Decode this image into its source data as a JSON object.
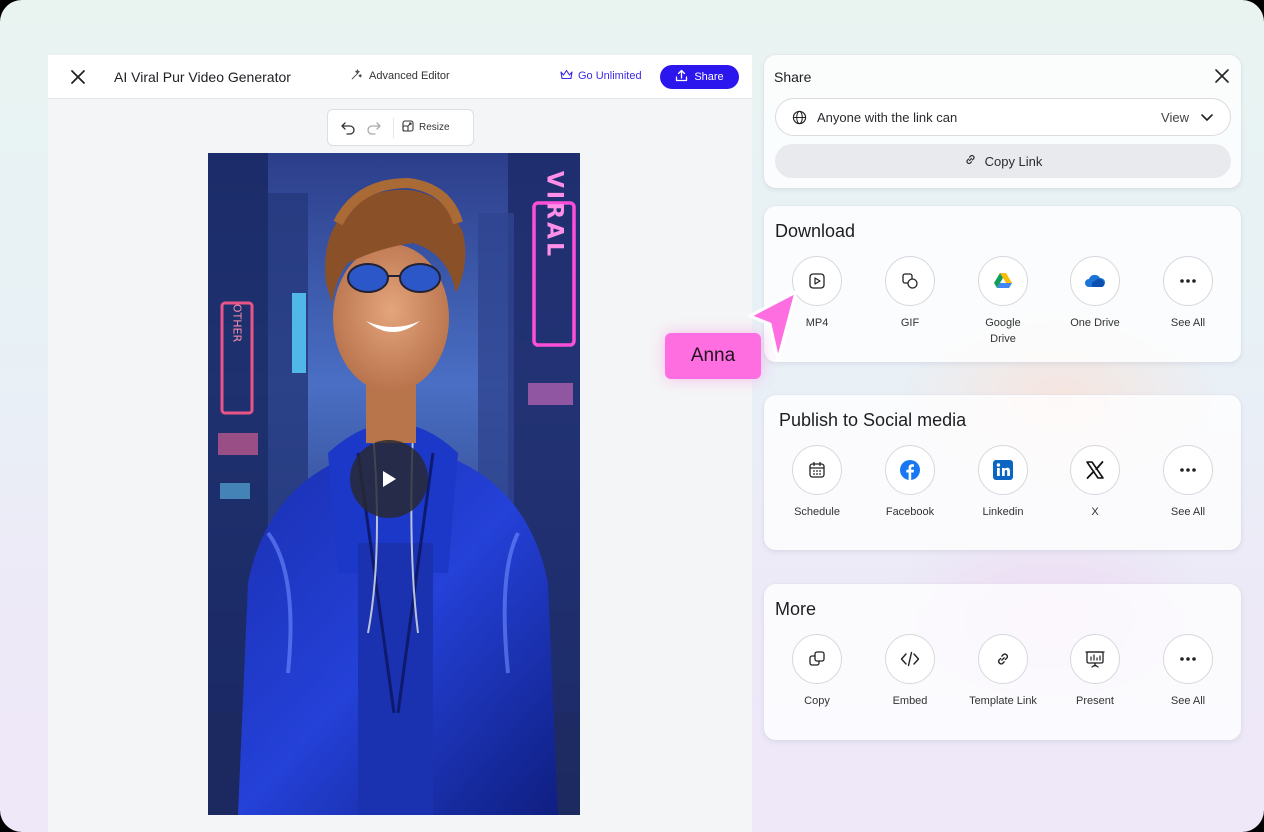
{
  "editor": {
    "title": "AI Viral Pur Video Generator",
    "advanced_editor": "Advanced Editor",
    "go_unlimited": "Go Unlimited",
    "share_button": "Share",
    "resize": "Resize",
    "video_sign_text": "VIRAL",
    "video_side_sign_text": "OTHER"
  },
  "share_panel": {
    "title": "Share",
    "link_access_text": "Anyone with the link can",
    "link_permission": "View",
    "copy_link": "Copy Link"
  },
  "download": {
    "title": "Download",
    "items": [
      {
        "label": "MP4",
        "icon": "play-square-icon"
      },
      {
        "label": "GIF",
        "icon": "gif-icon"
      },
      {
        "label": "Google Drive",
        "icon": "google-drive-icon"
      },
      {
        "label": "One Drive",
        "icon": "onedrive-icon"
      },
      {
        "label": "See All",
        "icon": "more-dots-icon"
      }
    ]
  },
  "social": {
    "title": "Publish to Social media",
    "items": [
      {
        "label": "Schedule",
        "icon": "calendar-icon"
      },
      {
        "label": "Facebook",
        "icon": "facebook-icon"
      },
      {
        "label": "Linkedin",
        "icon": "linkedin-icon"
      },
      {
        "label": "X",
        "icon": "x-icon"
      },
      {
        "label": "See All",
        "icon": "more-dots-icon"
      }
    ]
  },
  "more": {
    "title": "More",
    "items": [
      {
        "label": "Copy",
        "icon": "copy-icon"
      },
      {
        "label": "Embed",
        "icon": "code-icon"
      },
      {
        "label": "Template Link",
        "icon": "link-icon"
      },
      {
        "label": "Present",
        "icon": "presentation-icon"
      },
      {
        "label": "See All",
        "icon": "more-dots-icon"
      }
    ]
  },
  "collaborator": {
    "name": "Anna",
    "color": "#ff6ee0"
  },
  "colors": {
    "accent": "#2c16ee",
    "go_unlimited": "#3b2ae6"
  }
}
